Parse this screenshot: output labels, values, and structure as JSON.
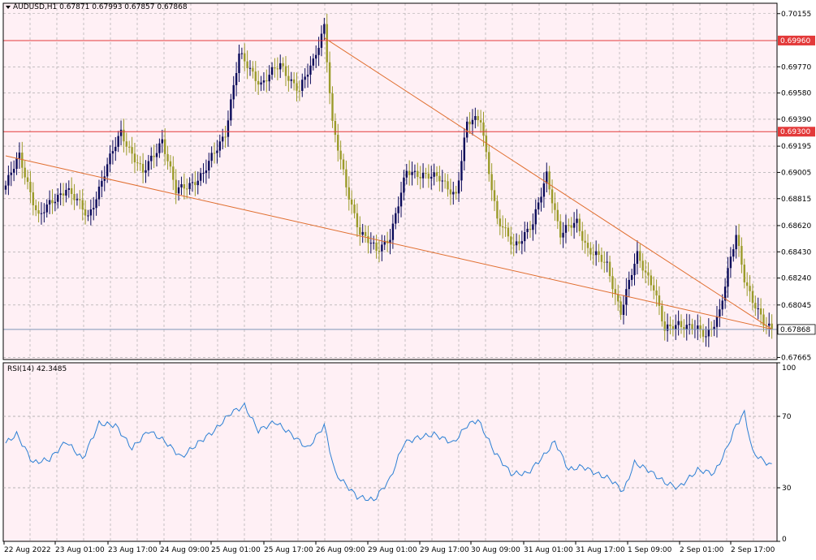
{
  "header": {
    "symbol_line": "AUDUSD,H1  0.67871 0.67993 0.67857 0.67868",
    "menu_icon": "triangle-down-icon"
  },
  "colors": {
    "background": "#fff0f5",
    "grid": "#a0a0a0",
    "bull": "#0a0a5a",
    "bear": "#9b9b2a",
    "level_line": "#e33a3a",
    "trendline": "#e06e2e",
    "bid_line": "#7f96b8",
    "rsi": "#2b7fd4"
  },
  "price_axis": {
    "labels": [
      "0.70155",
      "0.69770",
      "0.69580",
      "0.69390",
      "0.69195",
      "0.69005",
      "0.68815",
      "0.68620",
      "0.68430",
      "0.68240",
      "0.68045",
      "0.67665"
    ],
    "min": 0.6765,
    "max": 0.7023
  },
  "price_levels": [
    {
      "label": "0.69960",
      "value": 0.6996
    },
    {
      "label": "0.69300",
      "value": 0.693
    }
  ],
  "current_price": {
    "label": "0.67868",
    "value": 0.67868
  },
  "time_axis": {
    "labels": [
      "22 Aug 2022",
      "23 Aug 01:00",
      "23 Aug 17:00",
      "24 Aug 09:00",
      "25 Aug 01:00",
      "25 Aug 17:00",
      "26 Aug 09:00",
      "29 Aug 01:00",
      "29 Aug 17:00",
      "30 Aug 09:00",
      "31 Aug 01:00",
      "31 Aug 17:00",
      "1 Sep 09:00",
      "2 Sep 01:00",
      "2 Sep 17:00"
    ]
  },
  "rsi": {
    "title": "RSI(14) 42.3485",
    "axis_labels": [
      "100",
      "70",
      "30",
      "0"
    ],
    "levels": [
      70,
      30
    ]
  },
  "chart_data": {
    "type": "candlestick",
    "title": "AUDUSD,H1",
    "ylim": [
      0.6765,
      0.7023
    ],
    "anchors": [
      [
        0,
        0.6891
      ],
      [
        5,
        0.6912
      ],
      [
        12,
        0.6868
      ],
      [
        22,
        0.689
      ],
      [
        30,
        0.6868
      ],
      [
        37,
        0.6905
      ],
      [
        42,
        0.693
      ],
      [
        50,
        0.6899
      ],
      [
        57,
        0.6925
      ],
      [
        62,
        0.6886
      ],
      [
        72,
        0.6899
      ],
      [
        80,
        0.693
      ],
      [
        85,
        0.6985
      ],
      [
        93,
        0.6965
      ],
      [
        100,
        0.6978
      ],
      [
        107,
        0.696
      ],
      [
        112,
        0.698
      ],
      [
        116,
        0.7008
      ],
      [
        119,
        0.6935
      ],
      [
        124,
        0.689
      ],
      [
        129,
        0.6858
      ],
      [
        135,
        0.6843
      ],
      [
        140,
        0.6855
      ],
      [
        146,
        0.69
      ],
      [
        152,
        0.69
      ],
      [
        158,
        0.6895
      ],
      [
        164,
        0.6885
      ],
      [
        168,
        0.6935
      ],
      [
        173,
        0.694
      ],
      [
        179,
        0.6865
      ],
      [
        185,
        0.6848
      ],
      [
        192,
        0.6862
      ],
      [
        197,
        0.69
      ],
      [
        202,
        0.6855
      ],
      [
        208,
        0.6865
      ],
      [
        212,
        0.6845
      ],
      [
        219,
        0.6833
      ],
      [
        224,
        0.68
      ],
      [
        230,
        0.684
      ],
      [
        236,
        0.6818
      ],
      [
        240,
        0.6785
      ],
      [
        245,
        0.6792
      ],
      [
        250,
        0.6788
      ],
      [
        255,
        0.6782
      ],
      [
        260,
        0.68
      ],
      [
        266,
        0.6855
      ],
      [
        269,
        0.6825
      ],
      [
        272,
        0.6808
      ],
      [
        276,
        0.679
      ],
      [
        279,
        0.6787
      ]
    ],
    "trendlines": [
      {
        "from": [
          0,
          0.69125
        ],
        "to": [
          279,
          0.6787
        ]
      },
      {
        "from": [
          116,
          0.6998
        ],
        "to": [
          279,
          0.6787
        ]
      }
    ],
    "rsi_anchors": [
      [
        0,
        55
      ],
      [
        4,
        60
      ],
      [
        10,
        44
      ],
      [
        16,
        46
      ],
      [
        22,
        56
      ],
      [
        28,
        46
      ],
      [
        34,
        66
      ],
      [
        40,
        65
      ],
      [
        46,
        52
      ],
      [
        52,
        62
      ],
      [
        58,
        56
      ],
      [
        64,
        47
      ],
      [
        70,
        55
      ],
      [
        76,
        62
      ],
      [
        82,
        72
      ],
      [
        87,
        76
      ],
      [
        92,
        62
      ],
      [
        98,
        67
      ],
      [
        104,
        60
      ],
      [
        110,
        52
      ],
      [
        116,
        65
      ],
      [
        120,
        38
      ],
      [
        128,
        25
      ],
      [
        134,
        23
      ],
      [
        140,
        35
      ],
      [
        145,
        55
      ],
      [
        150,
        58
      ],
      [
        156,
        60
      ],
      [
        163,
        55
      ],
      [
        168,
        65
      ],
      [
        172,
        68
      ],
      [
        178,
        50
      ],
      [
        184,
        38
      ],
      [
        190,
        38
      ],
      [
        196,
        48
      ],
      [
        200,
        56
      ],
      [
        205,
        40
      ],
      [
        210,
        42
      ],
      [
        215,
        38
      ],
      [
        220,
        35
      ],
      [
        225,
        28
      ],
      [
        229,
        44
      ],
      [
        234,
        40
      ],
      [
        240,
        33
      ],
      [
        245,
        30
      ],
      [
        252,
        40
      ],
      [
        258,
        38
      ],
      [
        262,
        50
      ],
      [
        266,
        65
      ],
      [
        269,
        72
      ],
      [
        272,
        50
      ],
      [
        276,
        45
      ],
      [
        279,
        42.35
      ]
    ]
  }
}
